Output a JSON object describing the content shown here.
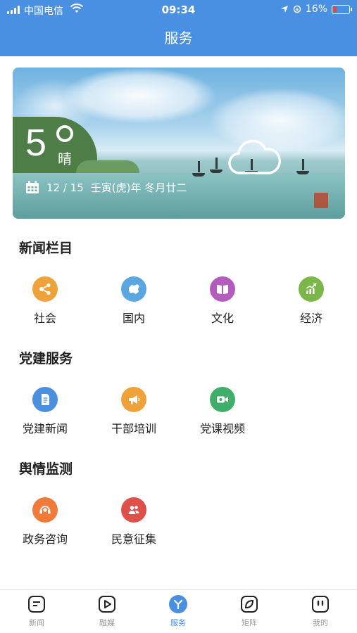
{
  "status_bar": {
    "carrier": "中国电信",
    "time": "09:34",
    "battery": "16%"
  },
  "header": {
    "title": "服务"
  },
  "weather": {
    "temperature": "5",
    "condition": "晴",
    "date": "12 / 15",
    "lunar_date": "壬寅(虎)年 冬月廿二",
    "icon": "cloud-icon"
  },
  "sections": [
    {
      "title": "新闻栏目",
      "items": [
        {
          "label": "社会",
          "icon": "share-nodes-icon",
          "color": "#f0a23a"
        },
        {
          "label": "国内",
          "icon": "china-map-icon",
          "color": "#5aa6e0"
        },
        {
          "label": "文化",
          "icon": "book-icon",
          "color": "#b45bbf"
        },
        {
          "label": "经济",
          "icon": "rising-chart-icon",
          "color": "#7ab648"
        }
      ]
    },
    {
      "title": "党建服务",
      "items": [
        {
          "label": "党建新闻",
          "icon": "document-icon",
          "color": "#4a8fe0"
        },
        {
          "label": "干部培训",
          "icon": "megaphone-icon",
          "color": "#f0a23a"
        },
        {
          "label": "党课视频",
          "icon": "video-camera-icon",
          "color": "#3fae6a"
        }
      ]
    },
    {
      "title": "舆情监测",
      "items": [
        {
          "label": "政务咨询",
          "icon": "headset-icon",
          "color": "#f07a3a"
        },
        {
          "label": "民意征集",
          "icon": "people-icon",
          "color": "#e0504a"
        }
      ]
    }
  ],
  "tabbar": {
    "tabs": [
      {
        "label": "新闻",
        "icon": "news-icon",
        "active": false
      },
      {
        "label": "融媒",
        "icon": "play-icon",
        "active": false
      },
      {
        "label": "服务",
        "icon": "service-icon",
        "active": true
      },
      {
        "label": "矩阵",
        "icon": "leaf-icon",
        "active": false
      },
      {
        "label": "我的",
        "icon": "profile-icon",
        "active": false
      }
    ]
  },
  "colors": {
    "primary": "#4a90e2"
  }
}
